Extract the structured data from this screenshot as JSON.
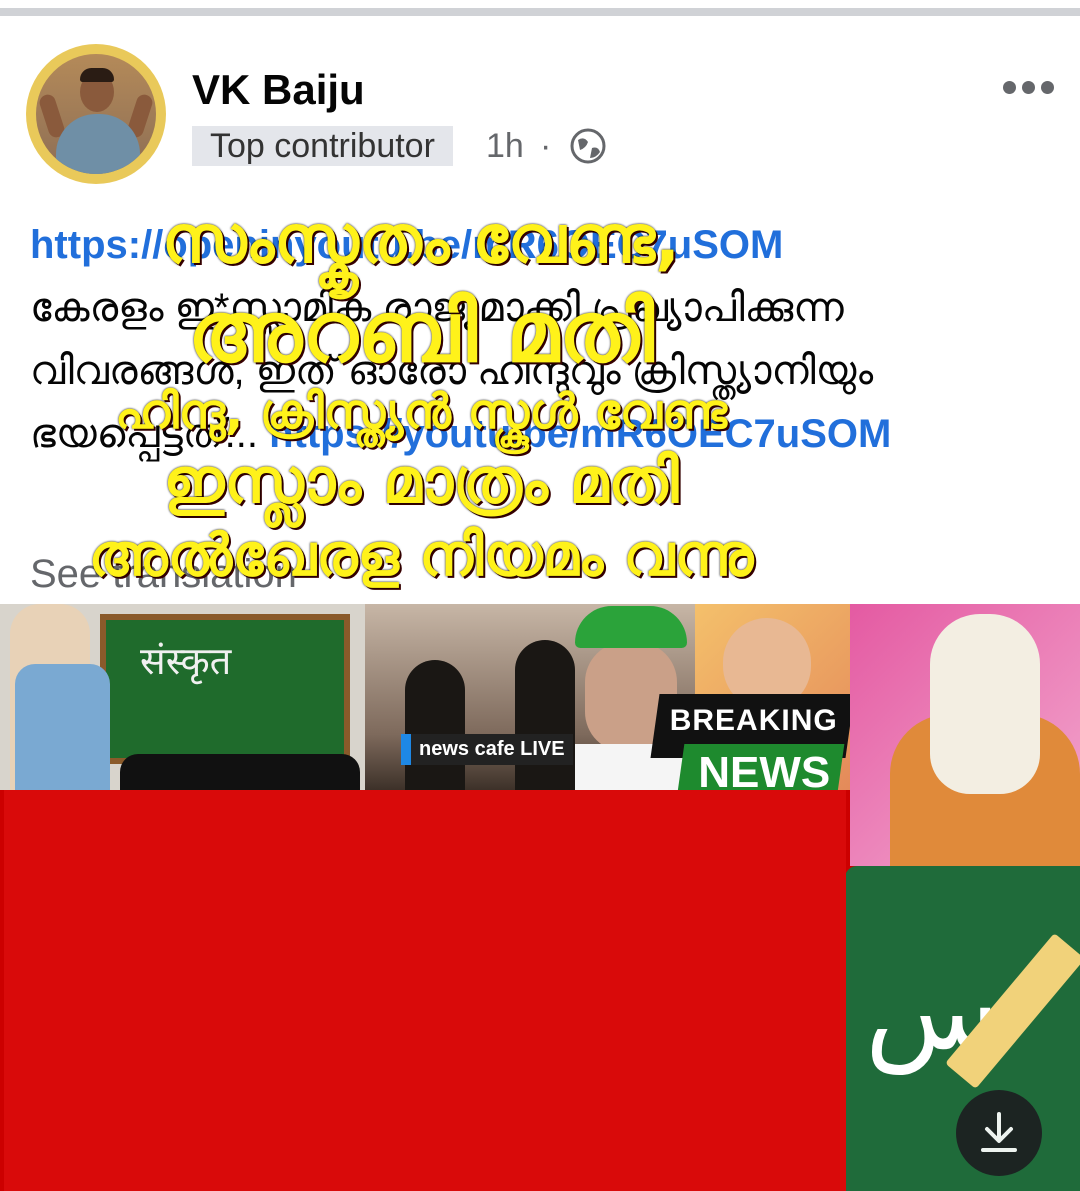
{
  "author": {
    "name": "VK Baiju",
    "badge": "Top contributor",
    "time": "1h",
    "separator": "·"
  },
  "post": {
    "link_top": "https://openinyoutu.be/mR6OEC7uSOM",
    "text": "കേരളം ഇ*സ്ലാമിക രാജ്യമാക്കി പ്രഖ്യാപിക്കുന്ന വിവരങ്ങൾ, ഇത് ഓരോ ഹിന്ദുവും ക്രിസ്ത്യാനിയും ഭയപ്പെട്ടത്...",
    "link_inline": "https://youtu.be/mR6OEC7uSOM",
    "see_translation": "See translation"
  },
  "thumbnail": {
    "board_word": "संस्कृत",
    "news_tag": "news cafe LIVE",
    "breaking": "BREAKING",
    "news": "NEWS",
    "arabic_glyph": "س",
    "headline": [
      "സംസ്കൃതം വേണ്ട,",
      "അറബി മതി",
      "ഹിന്ദു, ക്രിസ്ത്യൻ സ്കൂൾ വേണ്ട",
      "ഇസ്ലാം മാത്രം മതി",
      "അൽഖേരള നിയമം വന്നു"
    ]
  },
  "icons": {
    "more": "more-horizontal-icon",
    "audience": "globe-icon",
    "download": "download-icon"
  },
  "colors": {
    "link": "#216fdb",
    "meta": "#65676b",
    "headline": "#fff21a",
    "panel": "#d90a0a"
  }
}
